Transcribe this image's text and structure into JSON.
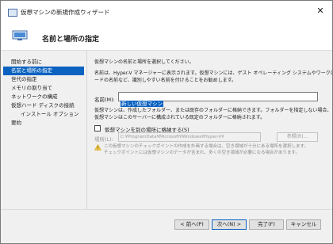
{
  "window": {
    "title": "仮想マシンの新規作成ウィザード",
    "close_glyph": "✕"
  },
  "banner": {
    "title": "名前と場所の指定"
  },
  "nav": {
    "items": [
      {
        "label": "開始する前に",
        "active": false,
        "sub": false
      },
      {
        "label": "名前と場所の指定",
        "active": true,
        "sub": false
      },
      {
        "label": "世代の指定",
        "active": false,
        "sub": false
      },
      {
        "label": "メモリの割り当て",
        "active": false,
        "sub": false
      },
      {
        "label": "ネットワークの構成",
        "active": false,
        "sub": false
      },
      {
        "label": "仮想ハード ディスクの接続",
        "active": false,
        "sub": false
      },
      {
        "label": "インストール オプション",
        "active": false,
        "sub": true
      },
      {
        "label": "要約",
        "active": false,
        "sub": false
      }
    ]
  },
  "content": {
    "intro": "仮想マシンの名前と場所を選択してください。",
    "desc_line1": "名前は、Hyper-V マネージャーに表示されます。仮想マシンには、ゲスト オペレーティング システムやワークロ",
    "desc_line2": "ードの名前など、識別しやすい名前を付けることをお勧めします。",
    "name_label": "名前(M):",
    "name_value": "新しい仮想マシン",
    "folder_line1": "仮想マシンは、作成したフォルダー、または既存のフォルダーに格納できます。フォルダーを指定しない場合、",
    "folder_line2": "仮想マシンはこのサーバーに構成されている既定のフォルダーに格納されます。",
    "store_checkbox_label": "仮想マシンを別の場所に格納する(S)",
    "store_checked": false,
    "location_label": "場所(L):",
    "location_value": "C:¥ProgramData¥Microsoft¥Windows¥Hyper-V¥",
    "browse_label": "参照(R)...",
    "warning_line1": "この仮想マシンのチェックポイントの作成を計画する場合は、空き領域が十分にある場所を選択します。",
    "warning_line2": "チェックポイントには仮想マシンのデータが含まれ、多くの空き領域が必要になる場合があります。"
  },
  "footer": {
    "back_label": "< 前へ(P)",
    "next_label": "次へ(N) >",
    "finish_label": "完了(F)",
    "cancel_label": "キャンセル"
  },
  "colors": {
    "accent": "#0b62c1",
    "warning": "#f2c94c"
  }
}
